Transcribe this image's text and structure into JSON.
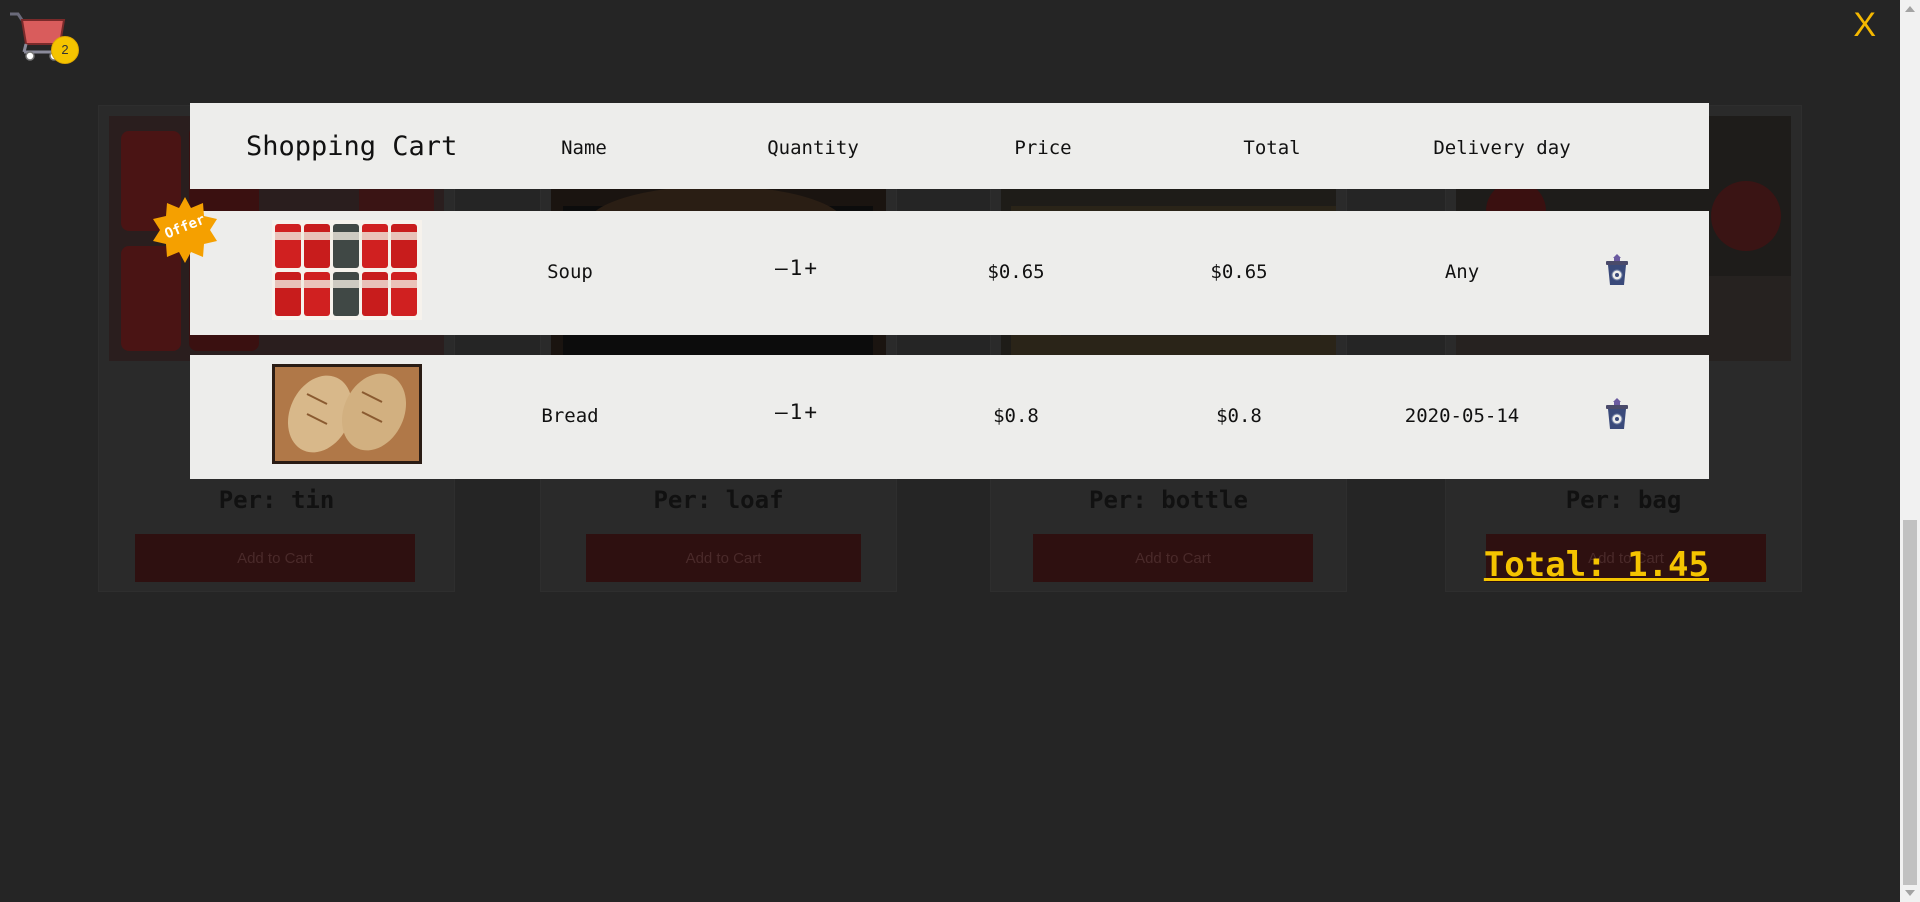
{
  "cart_icon": {
    "icon": "shopping-cart-icon",
    "count": "2"
  },
  "close_label": "X",
  "shop": {
    "products": [
      {
        "per": "Per: tin",
        "add_label": "Add to Cart"
      },
      {
        "per": "Per: loaf",
        "add_label": "Add to Cart"
      },
      {
        "per": "Per: bottle",
        "add_label": "Add to Cart"
      },
      {
        "per": "Per: bag",
        "add_label": "Add to Cart"
      }
    ]
  },
  "cart": {
    "title": "Shopping Cart",
    "headers": {
      "name": "Name",
      "quantity": "Quantity",
      "price": "Price",
      "total": "Total",
      "delivery": "Delivery day"
    },
    "items": [
      {
        "name": "Soup",
        "minus": "—",
        "quantity": "1",
        "plus": "+",
        "price": "$0.65",
        "total": "$0.65",
        "delivery": "Any",
        "badge": "Offer"
      },
      {
        "name": "Bread",
        "minus": "—",
        "quantity": "1",
        "plus": "+",
        "price": "$0.8",
        "total": "$0.8",
        "delivery": "2020-05-14"
      }
    ],
    "grand_total": "Total: 1.45"
  },
  "colors": {
    "accent": "#f5c400",
    "panel": "#ededeb",
    "background": "#252525",
    "offer": "#f5a000"
  }
}
